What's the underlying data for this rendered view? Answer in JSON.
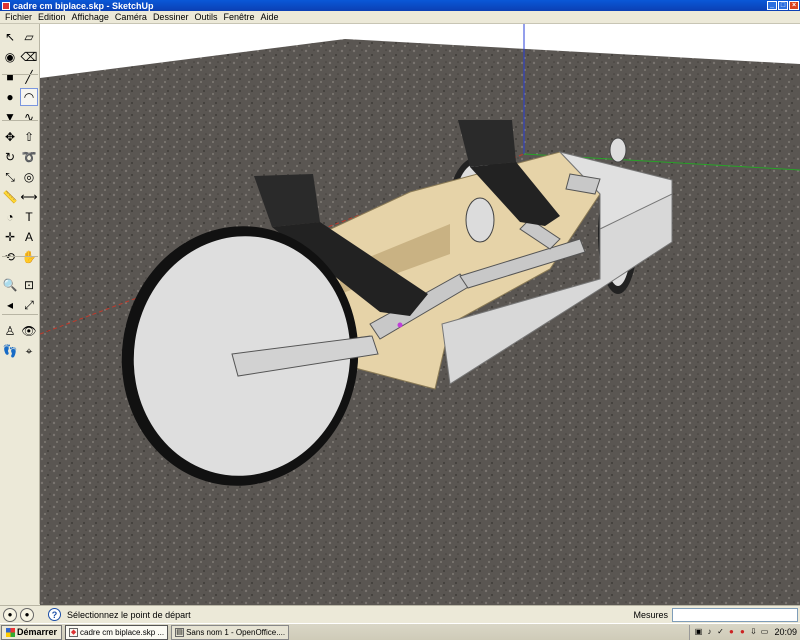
{
  "window": {
    "title": "cadre cm biplace.skp - SketchUp",
    "min": "_",
    "max": "□",
    "close": "×"
  },
  "menu": [
    "Fichier",
    "Edition",
    "Affichage",
    "Caméra",
    "Dessiner",
    "Outils",
    "Fenêtre",
    "Aide"
  ],
  "tools": [
    {
      "name": "select-icon",
      "glyph": "↖"
    },
    {
      "name": "make-component-icon",
      "glyph": "▱"
    },
    {
      "name": "paint-bucket-icon",
      "glyph": "◉"
    },
    {
      "name": "eraser-icon",
      "glyph": "⌫"
    },
    {
      "name": "rectangle-icon",
      "glyph": "■"
    },
    {
      "name": "line-icon",
      "glyph": "╱"
    },
    {
      "name": "circle-icon",
      "glyph": "●"
    },
    {
      "name": "arc-icon",
      "glyph": "◠"
    },
    {
      "name": "polygon-icon",
      "glyph": "▼"
    },
    {
      "name": "freehand-icon",
      "glyph": "∿"
    },
    {
      "name": "move-icon",
      "glyph": "✥"
    },
    {
      "name": "push-pull-icon",
      "glyph": "⇧"
    },
    {
      "name": "rotate-icon",
      "glyph": "↻"
    },
    {
      "name": "follow-me-icon",
      "glyph": "➰"
    },
    {
      "name": "scale-icon",
      "glyph": "⤡"
    },
    {
      "name": "offset-icon",
      "glyph": "◎"
    },
    {
      "name": "tape-measure-icon",
      "glyph": "📏"
    },
    {
      "name": "dimension-icon",
      "glyph": "⟷"
    },
    {
      "name": "protractor-icon",
      "glyph": "◔"
    },
    {
      "name": "text-icon",
      "glyph": "T"
    },
    {
      "name": "axes-icon",
      "glyph": "✛"
    },
    {
      "name": "3d-text-icon",
      "glyph": "A"
    },
    {
      "name": "orbit-icon",
      "glyph": "⟲"
    },
    {
      "name": "pan-icon",
      "glyph": "✋"
    },
    {
      "name": "zoom-icon",
      "glyph": "🔍"
    },
    {
      "name": "zoom-window-icon",
      "glyph": "⊡"
    },
    {
      "name": "previous-view-icon",
      "glyph": "◂"
    },
    {
      "name": "zoom-extents-icon",
      "glyph": "⤢"
    },
    {
      "name": "position-camera-icon",
      "glyph": "♙"
    },
    {
      "name": "look-around-icon",
      "glyph": "👁"
    },
    {
      "name": "walk-icon",
      "glyph": "👣"
    },
    {
      "name": "section-plane-icon",
      "glyph": "⌖"
    }
  ],
  "status": {
    "hint": "Sélectionnez le point de départ",
    "measures_label": "Mesures",
    "measures_value": ""
  },
  "taskbar": {
    "start": "Démarrer",
    "buttons": [
      {
        "label": "cadre cm biplace.skp ...",
        "active": true
      },
      {
        "label": "Sans nom 1 - OpenOffice....",
        "active": false
      }
    ],
    "clock": "20:09"
  },
  "colors": {
    "ground": "#5a5652",
    "sky": "#ffffff",
    "panel": "#e6d3a8",
    "panel_dark": "#c9b283",
    "side_panel": "#d8d8d8",
    "wheel_tire": "#222222",
    "wheel_disc": "#dedede",
    "seat": "#2a2a2a",
    "frame": "#c8c8c8",
    "axis_red": "#c0392b",
    "axis_green": "#27a327",
    "axis_blue": "#2a3fd8"
  }
}
